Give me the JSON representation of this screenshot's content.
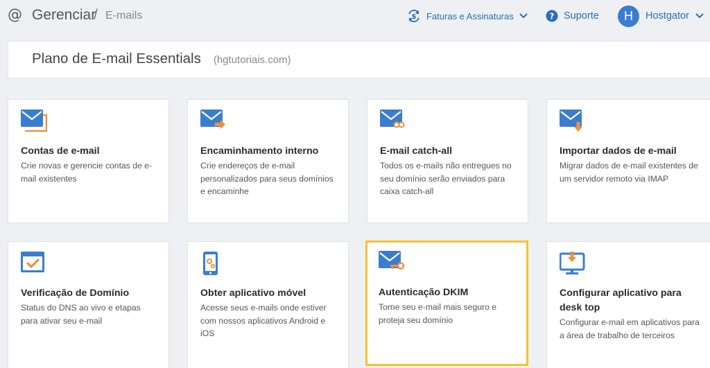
{
  "header": {
    "breadcrumb_main": "Gerenciar",
    "breadcrumb_separator": "/",
    "breadcrumb_sub": "E-mails",
    "invoices_label": "Faturas e Assinaturas",
    "support_label": "Suporte",
    "user_initial": "H",
    "user_name": "Hostgator"
  },
  "plan": {
    "title": "Plano de E-mail Essentials",
    "domain": "(hgtutoriais.com)"
  },
  "cards": [
    {
      "title": "Contas de e-mail",
      "description": "Crie novas e gerencie contas de e-mail existentes",
      "icon": "email-accounts-icon"
    },
    {
      "title": "Encaminhamento interno",
      "description": "Crie endereços de e-mail personalizados para seus domínios e encaminhe",
      "icon": "email-forward-icon"
    },
    {
      "title": "E-mail catch-all",
      "description": "Todos os e-mails não entregues no seu domínio serão enviados para caixa catch-all",
      "icon": "email-catch-all-icon"
    },
    {
      "title": "Importar dados de e-mail",
      "description": "Migrar dados de e-mail existentes de um servidor remoto via IMAP",
      "icon": "email-import-icon"
    },
    {
      "title": "Verificação de Domínio",
      "description": "Status do DNS ao vivo e etapas para ativar seu e-mail",
      "icon": "domain-verification-icon"
    },
    {
      "title": "Obter aplicativo móvel",
      "description": "Acesse seus e-mails onde estiver com nossos aplicativos Android e iOS",
      "icon": "mobile-app-icon"
    },
    {
      "title": "Autenticação DKIM",
      "description": "Torne seu e-mail mais seguro e proteja seu domínio",
      "icon": "email-key-icon"
    },
    {
      "title": "Configurar aplicativo para desk top",
      "description": "Configurar e-mail em aplicativos para a área de trabalho de terceiros",
      "icon": "desktop-monitor-icon"
    }
  ],
  "colors": {
    "accent_blue": "#2c6db6",
    "icon_blue": "#3a7dd0",
    "icon_orange": "#f0913a",
    "highlight": "#f5c32e",
    "background": "#eef0f3"
  }
}
